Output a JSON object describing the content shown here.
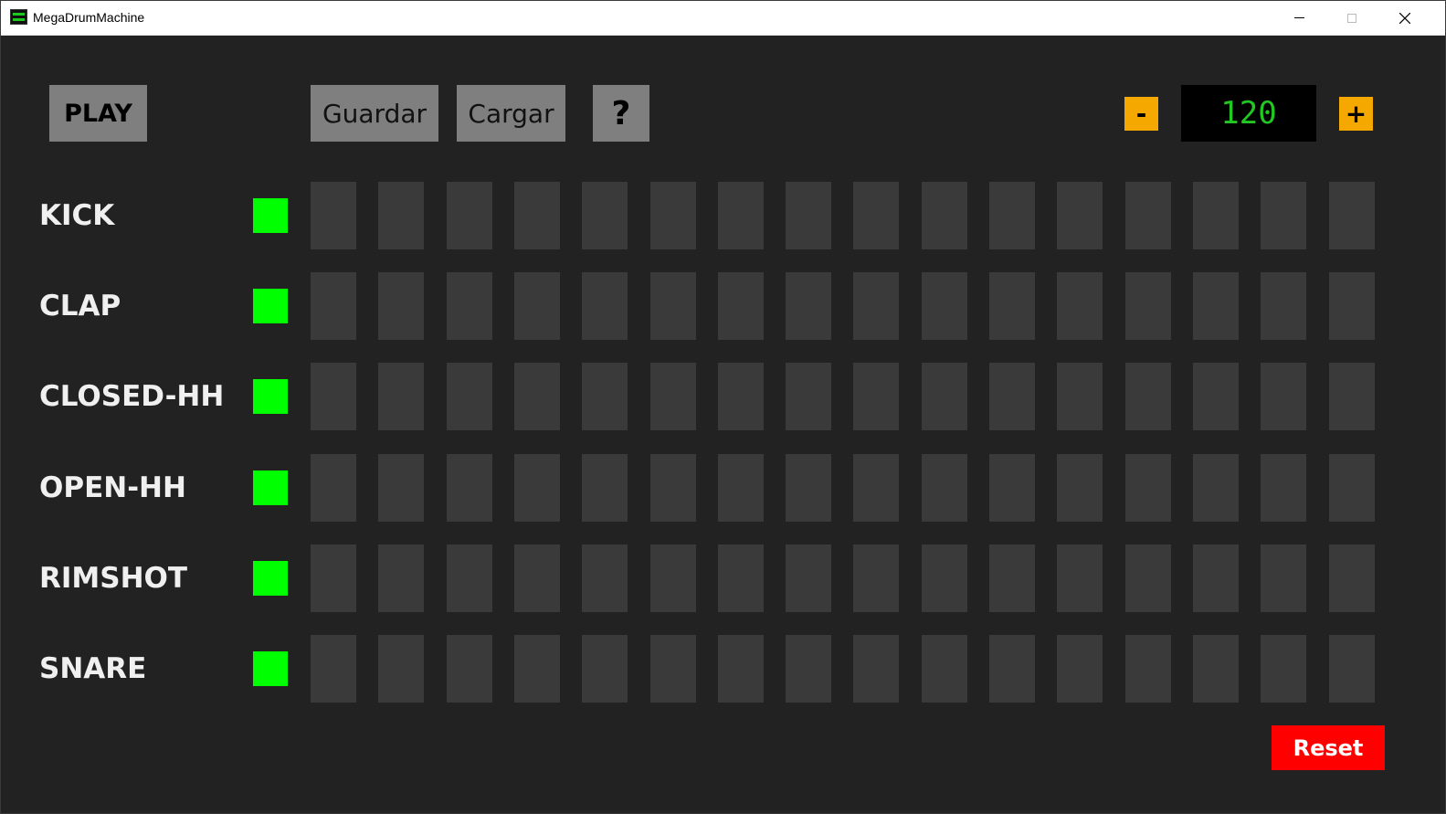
{
  "window": {
    "title": "MegaDrumMachine"
  },
  "transport": {
    "play_label": "PLAY",
    "save_label": "Guardar",
    "load_label": "Cargar",
    "help_label": "?"
  },
  "tempo": {
    "minus_label": "-",
    "value": "120",
    "plus_label": "+"
  },
  "tracks": [
    {
      "name": "KICK",
      "steps": [
        0,
        0,
        0,
        0,
        0,
        0,
        0,
        0,
        0,
        0,
        0,
        0,
        0,
        0,
        0,
        0
      ]
    },
    {
      "name": "CLAP",
      "steps": [
        0,
        0,
        0,
        0,
        0,
        0,
        0,
        0,
        0,
        0,
        0,
        0,
        0,
        0,
        0,
        0
      ]
    },
    {
      "name": "CLOSED-HH",
      "steps": [
        0,
        0,
        0,
        0,
        0,
        0,
        0,
        0,
        0,
        0,
        0,
        0,
        0,
        0,
        0,
        0
      ]
    },
    {
      "name": "OPEN-HH",
      "steps": [
        0,
        0,
        0,
        0,
        0,
        0,
        0,
        0,
        0,
        0,
        0,
        0,
        0,
        0,
        0,
        0
      ]
    },
    {
      "name": "RIMSHOT",
      "steps": [
        0,
        0,
        0,
        0,
        0,
        0,
        0,
        0,
        0,
        0,
        0,
        0,
        0,
        0,
        0,
        0
      ]
    },
    {
      "name": "SNARE",
      "steps": [
        0,
        0,
        0,
        0,
        0,
        0,
        0,
        0,
        0,
        0,
        0,
        0,
        0,
        0,
        0,
        0
      ]
    }
  ],
  "footer": {
    "reset_label": "Reset"
  },
  "colors": {
    "background": "#222222",
    "step_off": "#3a3a3a",
    "track_indicator": "#00ff00",
    "tempo_buttons": "#f5a900",
    "tempo_text": "#22c822",
    "reset": "#ff0000"
  }
}
